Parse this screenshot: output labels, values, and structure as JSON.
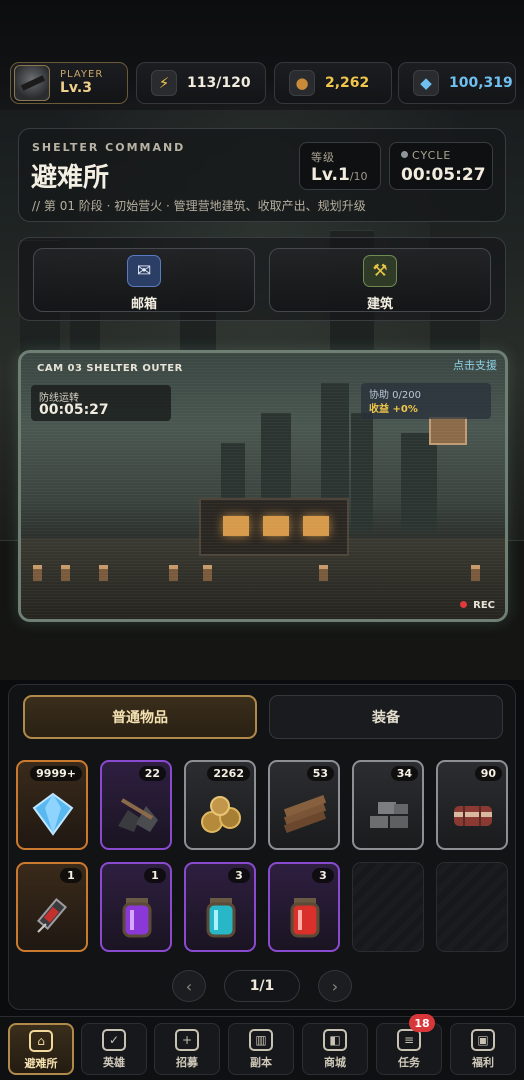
{
  "colors": {
    "accent_gold": "#b08a4a",
    "rarity_orange": "#c97a2e",
    "rarity_purple": "#8a4ad0",
    "rarity_gray": "#8c8f93",
    "badge_red": "#d8373a"
  },
  "topbar": {
    "player_label": "PLAYER",
    "player_level": "Lv.3",
    "resources": [
      {
        "icon": "lightning-icon",
        "value": "113/120",
        "color": "#f2ecdf"
      },
      {
        "icon": "coin-bag-icon",
        "value": "2,262",
        "color": "#f0c64c"
      },
      {
        "icon": "diamond-icon",
        "value": "100,319",
        "color": "#6fc0f0"
      }
    ]
  },
  "command": {
    "subtitle": "SHELTER COMMAND",
    "title": "避难所",
    "description": "// 第 01 阶段 · 初始营火 · 管理营地建筑、收取产出、规划升级",
    "level_label": "等级",
    "level_value": "Lv.1",
    "level_max": "/10",
    "cycle_label": "CYCLE",
    "cycle_value": "00:05:27"
  },
  "actions": {
    "mail_label": "邮箱",
    "build_label": "建筑"
  },
  "camera": {
    "tag": "CAM 03  SHELTER OUTER",
    "support_link": "点击支援",
    "defense_label": "防线运转",
    "defense_time": "00:05:27",
    "assist_label": "协助 0/200",
    "assist_gain": "收益 +0%",
    "rec_label": "REC"
  },
  "inventory": {
    "tabs": [
      "普通物品",
      "装备"
    ],
    "items": [
      {
        "name": "diamond-item",
        "count": "9999+",
        "rarity": "orange"
      },
      {
        "name": "ore-item",
        "count": "22",
        "rarity": "purple"
      },
      {
        "name": "coins-item",
        "count": "2262",
        "rarity": "gray"
      },
      {
        "name": "wood-item",
        "count": "53",
        "rarity": "gray"
      },
      {
        "name": "stone-item",
        "count": "34",
        "rarity": "gray"
      },
      {
        "name": "meat-item",
        "count": "90",
        "rarity": "gray"
      },
      {
        "name": "syringe-item",
        "count": "1",
        "rarity": "orange"
      },
      {
        "name": "purple-potion-item",
        "count": "1",
        "rarity": "purple"
      },
      {
        "name": "cyan-potion-item",
        "count": "3",
        "rarity": "purple"
      },
      {
        "name": "red-potion-item",
        "count": "3",
        "rarity": "purple"
      }
    ],
    "page": "1/1"
  },
  "nav": {
    "items": [
      "避难所",
      "英雄",
      "招募",
      "副本",
      "商城",
      "任务",
      "福利"
    ],
    "task_badge": "18"
  }
}
